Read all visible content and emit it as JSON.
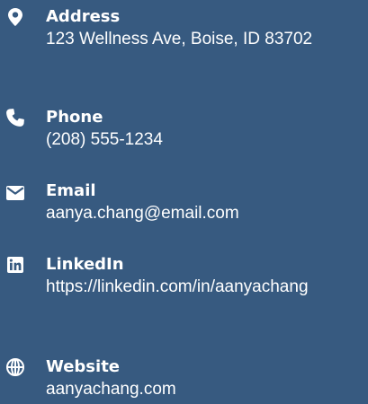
{
  "colors": {
    "background": "#375a80",
    "text": "#ffffff"
  },
  "contacts": [
    {
      "icon": "map-marker-icon",
      "label": "Address",
      "value": "123 Wellness Ave, Boise, ID 83702"
    },
    {
      "icon": "phone-icon",
      "label": "Phone",
      "value": "(208) 555-1234"
    },
    {
      "icon": "envelope-icon",
      "label": "Email",
      "value": "aanya.chang@email.com"
    },
    {
      "icon": "linkedin-icon",
      "label": "LinkedIn",
      "value": "https://linkedin.com/in/aanyachang"
    },
    {
      "icon": "globe-icon",
      "label": "Website",
      "value": "aanyachang.com"
    }
  ]
}
